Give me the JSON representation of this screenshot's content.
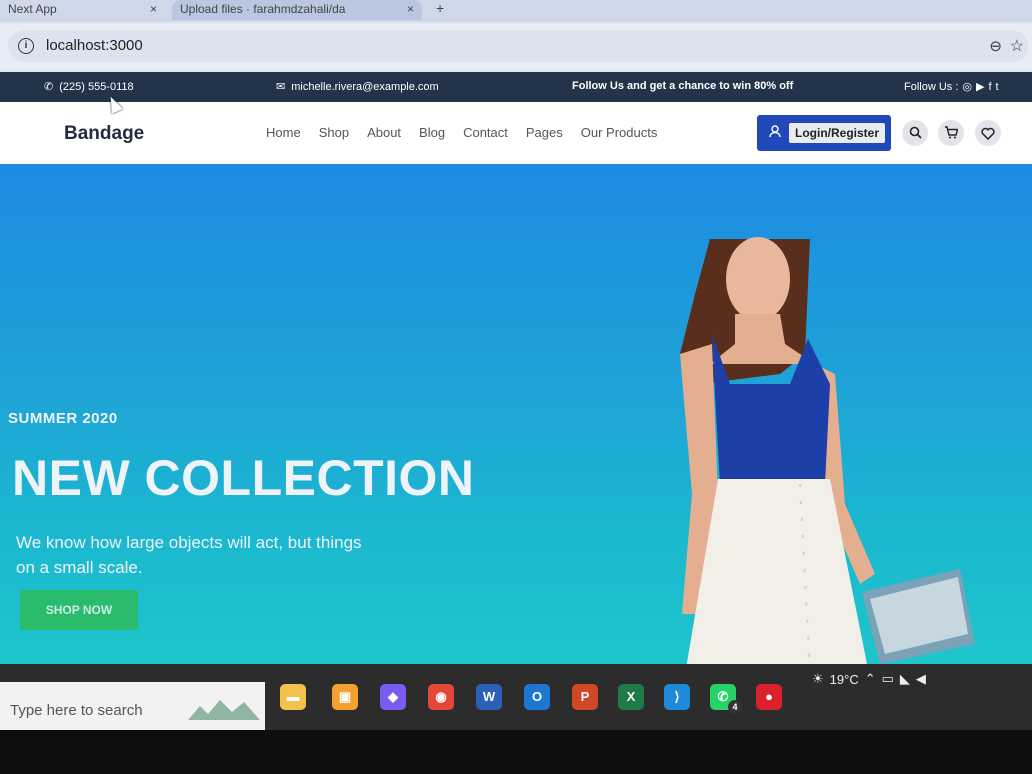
{
  "browser": {
    "tabs": [
      {
        "label": "Next App"
      },
      {
        "label": "Upload files · farahmdzahali/da"
      }
    ],
    "new_tab": "+",
    "close": "×",
    "url": "localhost:3000",
    "info_icon": "i",
    "zoom_icon": "⊖",
    "star_icon": "☆"
  },
  "topbar": {
    "phone": "(225) 555-0118",
    "email": "michelle.rivera@example.com",
    "promo": "Follow Us  and get a chance to win 80% off",
    "follow_label": "Follow Us :",
    "phone_icon": "✆",
    "mail_icon": "✉",
    "social_icons": [
      "◎",
      "▶",
      "f",
      "t"
    ]
  },
  "navbar": {
    "brand": "Bandage",
    "menu": [
      "Home",
      "Shop",
      "About",
      "Blog",
      "Contact",
      "Pages",
      "Our Products"
    ],
    "login_label": "Login/Register",
    "user_icon": "👤",
    "search_icon": "⌕",
    "cart_icon": "🛒",
    "heart_icon": "♡"
  },
  "hero": {
    "season": "SUMMER 2020",
    "headline": "NEW COLLECTION",
    "subtitle": "We know how large objects will act, but things on a small scale.",
    "cta": "SHOP NOW"
  },
  "taskbar": {
    "search_placeholder": "Type here to search",
    "apps": [
      {
        "name": "file-explorer",
        "glyph": "▬",
        "color": "#f2c14e"
      },
      {
        "name": "store",
        "glyph": "▣",
        "color": "#f3a12e"
      },
      {
        "name": "copilot",
        "glyph": "◆",
        "color": "#7a5cf0"
      },
      {
        "name": "chrome",
        "glyph": "◉",
        "color": "#e5463a"
      },
      {
        "name": "word",
        "glyph": "W",
        "color": "#2b5fb8"
      },
      {
        "name": "outlook",
        "glyph": "O",
        "color": "#1d77d0"
      },
      {
        "name": "powerpoint",
        "glyph": "P",
        "color": "#d24726"
      },
      {
        "name": "excel",
        "glyph": "X",
        "color": "#1f7a45"
      },
      {
        "name": "vscode",
        "glyph": "⟩",
        "color": "#1c8ad9"
      },
      {
        "name": "whatsapp",
        "glyph": "✆",
        "color": "#25d366"
      },
      {
        "name": "recorder",
        "glyph": "●",
        "color": "#d9202b"
      }
    ],
    "whatsapp_badge": "4",
    "temperature": "19°C"
  }
}
